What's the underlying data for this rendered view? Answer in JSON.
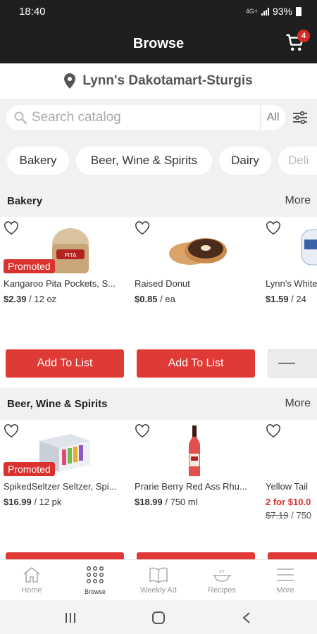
{
  "status": {
    "time": "18:40",
    "signal": "4G+",
    "battery": "93%"
  },
  "header": {
    "title": "Browse",
    "cart_count": "4"
  },
  "store": {
    "name": "Lynn's Dakotamart-Sturgis"
  },
  "search": {
    "placeholder": "Search catalog",
    "scope": "All"
  },
  "categories": [
    "Bakery",
    "Beer, Wine & Spirits",
    "Dairy",
    "Deli"
  ],
  "sections": [
    {
      "title": "Bakery",
      "more": "More",
      "products": [
        {
          "name": "Kangaroo Pita Pockets, S...",
          "badge": "Promoted",
          "price": "$2.39",
          "unit": " / 12 oz",
          "action": "Add To List"
        },
        {
          "name": "Raised Donut",
          "price": "$0.85",
          "unit": " / ea",
          "action": "Add To List"
        },
        {
          "name": "Lynn's White",
          "price": "$1.59",
          "unit": " / 24",
          "quantity_minus": "—"
        }
      ]
    },
    {
      "title": "Beer, Wine & Spirits",
      "more": "More",
      "products": [
        {
          "name": "SpikedSeltzer Seltzer, Spi...",
          "badge": "Promoted",
          "price": "$16.99",
          "unit": " / 12 pk"
        },
        {
          "name": "Prarie Berry Red Ass Rhu...",
          "price": "$18.99",
          "unit": " / 750 ml"
        },
        {
          "name": "Yellow Tail",
          "deal": "2 for $10.0",
          "old_price": "$7.19",
          "unit": " / 750"
        }
      ]
    }
  ],
  "bottom_nav": [
    {
      "label": "Home",
      "icon": "home-icon"
    },
    {
      "label": "Browse",
      "icon": "grid-icon",
      "active": true
    },
    {
      "label": "Weekly Ad",
      "icon": "book-icon"
    },
    {
      "label": "Recipes",
      "icon": "pot-icon"
    },
    {
      "label": "More",
      "icon": "menu-icon"
    }
  ],
  "colors": {
    "brand_red": "#E03A36",
    "header": "#1F1F1F",
    "background": "#F1F1F1"
  }
}
